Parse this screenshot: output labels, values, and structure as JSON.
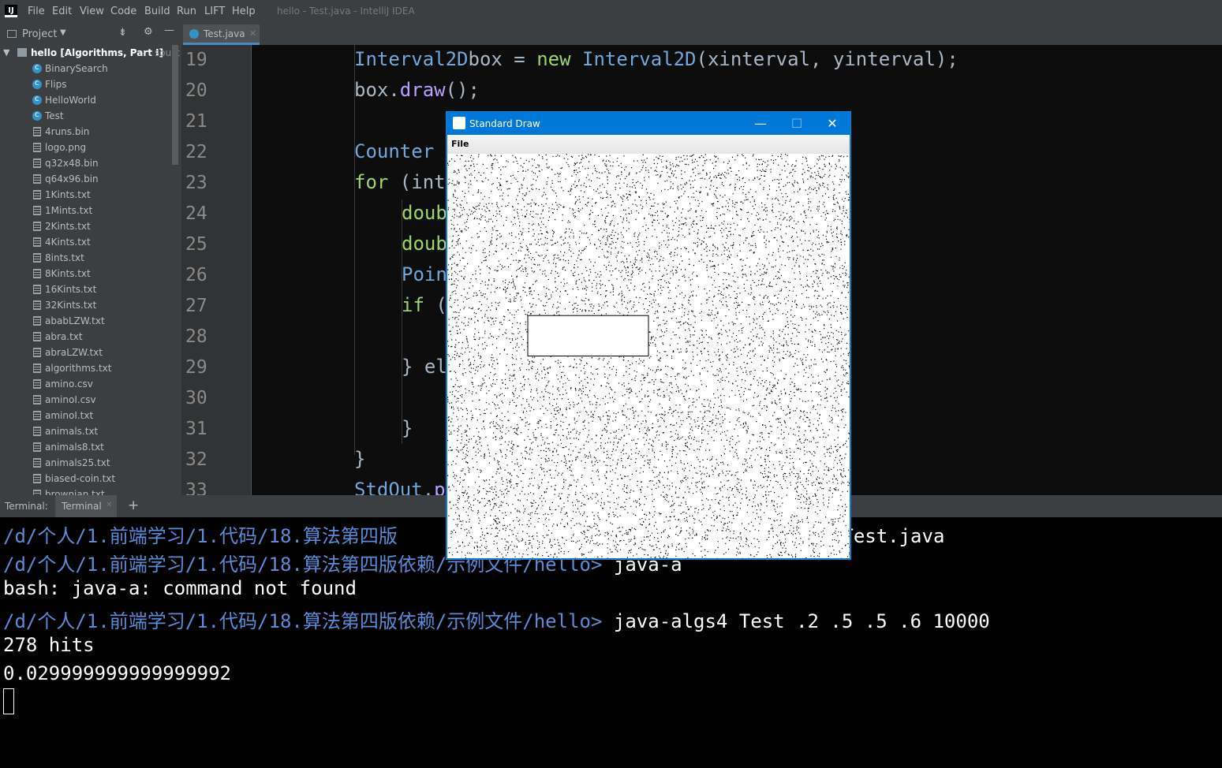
{
  "menubar": {
    "items": [
      "File",
      "Edit",
      "View",
      "Code",
      "Build",
      "Run",
      "LIFT",
      "Help"
    ],
    "window_title": "hello - Test.java - IntelliJ IDEA"
  },
  "project": {
    "header_label": "Project",
    "root": "hello [Algorithms, Part I]",
    "root_suffix": "sourc",
    "items": [
      {
        "label": "BinarySearch",
        "icon": "class-icon"
      },
      {
        "label": "Flips",
        "icon": "class-icon"
      },
      {
        "label": "HelloWorld",
        "icon": "class-icon"
      },
      {
        "label": "Test",
        "icon": "class-icon"
      },
      {
        "label": "4runs.bin",
        "icon": "file-icon"
      },
      {
        "label": "logo.png",
        "icon": "file-icon"
      },
      {
        "label": "q32x48.bin",
        "icon": "file-icon"
      },
      {
        "label": "q64x96.bin",
        "icon": "file-icon"
      },
      {
        "label": "1Kints.txt",
        "icon": "file-icon"
      },
      {
        "label": "1Mints.txt",
        "icon": "file-icon"
      },
      {
        "label": "2Kints.txt",
        "icon": "file-icon"
      },
      {
        "label": "4Kints.txt",
        "icon": "file-icon"
      },
      {
        "label": "8ints.txt",
        "icon": "file-icon"
      },
      {
        "label": "8Kints.txt",
        "icon": "file-icon"
      },
      {
        "label": "16Kints.txt",
        "icon": "file-icon"
      },
      {
        "label": "32Kints.txt",
        "icon": "file-icon"
      },
      {
        "label": "ababLZW.txt",
        "icon": "file-icon"
      },
      {
        "label": "abra.txt",
        "icon": "file-icon"
      },
      {
        "label": "abraLZW.txt",
        "icon": "file-icon"
      },
      {
        "label": "algorithms.txt",
        "icon": "file-icon"
      },
      {
        "label": "amino.csv",
        "icon": "file-icon"
      },
      {
        "label": "aminoI.csv",
        "icon": "file-icon"
      },
      {
        "label": "aminoI.txt",
        "icon": "file-icon"
      },
      {
        "label": "animals.txt",
        "icon": "file-icon"
      },
      {
        "label": "animals8.txt",
        "icon": "file-icon"
      },
      {
        "label": "animals25.txt",
        "icon": "file-icon"
      },
      {
        "label": "biased-coin.txt",
        "icon": "file-icon"
      },
      {
        "label": "brownian.txt",
        "icon": "file-icon"
      }
    ]
  },
  "editor": {
    "tab_label": "Test.java",
    "line_numbers": [
      "19",
      "20",
      "21",
      "22",
      "23",
      "24",
      "25",
      "26",
      "27",
      "28",
      "29",
      "30",
      "31",
      "32",
      "33"
    ],
    "lines": [
      [
        [
          "ty",
          "Interval2D"
        ],
        [
          "",
          "box = "
        ],
        [
          "kw",
          "new "
        ],
        [
          "ty",
          "Interval2D"
        ],
        [
          "",
          "(xinterval, yinterval);"
        ]
      ],
      [
        [
          "",
          "box."
        ],
        [
          "fn",
          "draw"
        ],
        [
          "",
          "();"
        ]
      ],
      [],
      [
        [
          "ty",
          "Counter"
        ]
      ],
      [
        [
          "kw",
          "for "
        ],
        [
          "",
          "(int"
        ]
      ],
      [
        [
          "kw",
          "doub"
        ]
      ],
      [
        [
          "kw",
          "doub"
        ]
      ],
      [
        [
          "ty",
          "Poin"
        ]
      ],
      [
        [
          "kw",
          "if "
        ],
        [
          "",
          "("
        ]
      ],
      [],
      [
        [
          "",
          "} el"
        ]
      ],
      [],
      [
        [
          "",
          "}"
        ]
      ],
      [
        [
          "",
          "}"
        ]
      ],
      [
        [
          "ty",
          "StdOut"
        ],
        [
          "",
          "."
        ],
        [
          "fn",
          "p"
        ]
      ]
    ]
  },
  "terminal": {
    "header_label": "Terminal:",
    "tab_label": "Terminal",
    "lines": [
      [
        [
          "prompt",
          "/d/个人/1.前端学习/1.代码/18.算法第四版"
        ],
        [
          "",
          "                                       Test.java"
        ]
      ],
      [
        [
          "prompt",
          "/d/个人/1.前端学习/1.代码/18.算法第四版依赖/示例文件/hello> "
        ],
        [
          "",
          "java-a"
        ]
      ],
      [
        [
          "",
          "bash: java-a: command not found"
        ]
      ],
      [
        [
          "prompt",
          "/d/个人/1.前端学习/1.代码/18.算法第四版依赖/示例文件/hello> "
        ],
        [
          "",
          "java-algs4 Test .2 .5 .5 .6 10000"
        ]
      ],
      [
        [
          "",
          "278 hits"
        ]
      ],
      [
        [
          "",
          "0.029999999999999992"
        ]
      ]
    ]
  },
  "std_draw": {
    "title": "Standard Draw",
    "menu": "File",
    "box": {
      "xinterval": [
        0.2,
        0.5
      ],
      "yinterval": [
        0.5,
        0.6
      ]
    },
    "points": 10000
  }
}
